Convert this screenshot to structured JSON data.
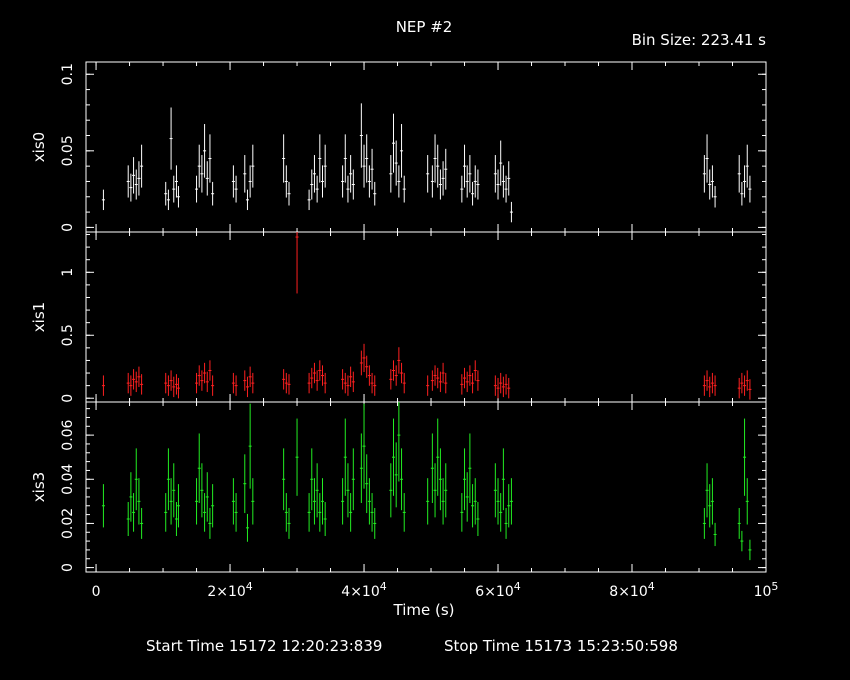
{
  "header": {
    "title": "NEP #2",
    "bin_size": "Bin Size: 223.41 s"
  },
  "footer": {
    "start_time": "Start Time 15172 12:20:23:839",
    "stop_time": "Stop Time 15173 15:23:50:598"
  },
  "chart_data": {
    "type": "scatter",
    "xlabel": "Time (s)",
    "xlim": [
      -1500,
      100000
    ],
    "x_ticks": [
      {
        "value": 0,
        "label": "0",
        "exp": ""
      },
      {
        "value": 20000,
        "label": "2×10",
        "exp": "4"
      },
      {
        "value": 40000,
        "label": "4×10",
        "exp": "4"
      },
      {
        "value": 60000,
        "label": "6×10",
        "exp": "4"
      },
      {
        "value": 80000,
        "label": "8×10",
        "exp": "4"
      },
      {
        "value": 100000,
        "label": "10",
        "exp": "5"
      }
    ],
    "panels": [
      {
        "name": "xis0",
        "ylabel": "xis0",
        "color": "#ffffff",
        "ylim": [
          -0.003,
          0.108
        ],
        "yticks": [
          0,
          0.05,
          0.1
        ],
        "ytick_labels": [
          "0",
          "0.05",
          "0.1"
        ],
        "points": [
          [
            1100,
            0.018
          ],
          [
            4800,
            0.03
          ],
          [
            5200,
            0.026
          ],
          [
            5600,
            0.034
          ],
          [
            6000,
            0.028
          ],
          [
            6400,
            0.032
          ],
          [
            6800,
            0.04
          ],
          [
            10400,
            0.022
          ],
          [
            10800,
            0.018
          ],
          [
            11200,
            0.058
          ],
          [
            11600,
            0.025
          ],
          [
            12000,
            0.03
          ],
          [
            12300,
            0.02
          ],
          [
            15000,
            0.025
          ],
          [
            15400,
            0.04
          ],
          [
            15800,
            0.035
          ],
          [
            16200,
            0.05
          ],
          [
            16600,
            0.032
          ],
          [
            17000,
            0.045
          ],
          [
            17400,
            0.022
          ],
          [
            20500,
            0.03
          ],
          [
            20900,
            0.025
          ],
          [
            22200,
            0.035
          ],
          [
            22600,
            0.018
          ],
          [
            23000,
            0.03
          ],
          [
            23400,
            0.04
          ],
          [
            28000,
            0.045
          ],
          [
            28400,
            0.03
          ],
          [
            28800,
            0.022
          ],
          [
            31800,
            0.018
          ],
          [
            32200,
            0.028
          ],
          [
            32600,
            0.035
          ],
          [
            33000,
            0.025
          ],
          [
            33400,
            0.045
          ],
          [
            33800,
            0.03
          ],
          [
            34200,
            0.04
          ],
          [
            36800,
            0.03
          ],
          [
            37200,
            0.045
          ],
          [
            37600,
            0.025
          ],
          [
            38000,
            0.035
          ],
          [
            38400,
            0.028
          ],
          [
            39600,
            0.06
          ],
          [
            40000,
            0.04
          ],
          [
            40400,
            0.045
          ],
          [
            40800,
            0.03
          ],
          [
            41200,
            0.038
          ],
          [
            41600,
            0.022
          ],
          [
            44000,
            0.035
          ],
          [
            44400,
            0.055
          ],
          [
            44800,
            0.042
          ],
          [
            45200,
            0.03
          ],
          [
            45600,
            0.05
          ],
          [
            46000,
            0.025
          ],
          [
            49500,
            0.035
          ],
          [
            50200,
            0.03
          ],
          [
            50600,
            0.045
          ],
          [
            51000,
            0.04
          ],
          [
            51400,
            0.028
          ],
          [
            51800,
            0.032
          ],
          [
            52200,
            0.038
          ],
          [
            54600,
            0.025
          ],
          [
            55000,
            0.04
          ],
          [
            55400,
            0.03
          ],
          [
            55800,
            0.035
          ],
          [
            56200,
            0.022
          ],
          [
            56600,
            0.03
          ],
          [
            57000,
            0.028
          ],
          [
            59600,
            0.035
          ],
          [
            60000,
            0.028
          ],
          [
            60400,
            0.042
          ],
          [
            60800,
            0.03
          ],
          [
            61200,
            0.025
          ],
          [
            61600,
            0.032
          ],
          [
            62000,
            0.01
          ],
          [
            90800,
            0.035
          ],
          [
            91200,
            0.045
          ],
          [
            91600,
            0.028
          ],
          [
            92000,
            0.03
          ],
          [
            92400,
            0.02
          ],
          [
            96000,
            0.035
          ],
          [
            96400,
            0.022
          ],
          [
            96800,
            0.03
          ],
          [
            97200,
            0.04
          ],
          [
            97600,
            0.025
          ]
        ]
      },
      {
        "name": "xis1",
        "ylabel": "xis1",
        "color": "#ff2020",
        "ylim": [
          -0.03,
          1.32
        ],
        "yticks": [
          0,
          0.5,
          1
        ],
        "ytick_labels": [
          "0",
          "0.5",
          "1"
        ],
        "points": [
          [
            1100,
            0.1
          ],
          [
            4800,
            0.12
          ],
          [
            5200,
            0.1
          ],
          [
            5600,
            0.15
          ],
          [
            6000,
            0.13
          ],
          [
            6400,
            0.17
          ],
          [
            6800,
            0.11
          ],
          [
            10400,
            0.12
          ],
          [
            10800,
            0.1
          ],
          [
            11200,
            0.14
          ],
          [
            11600,
            0.09
          ],
          [
            12000,
            0.11
          ],
          [
            12300,
            0.08
          ],
          [
            15000,
            0.12
          ],
          [
            15400,
            0.18
          ],
          [
            15800,
            0.14
          ],
          [
            16200,
            0.2
          ],
          [
            16600,
            0.13
          ],
          [
            17000,
            0.22
          ],
          [
            17400,
            0.1
          ],
          [
            20500,
            0.12
          ],
          [
            20900,
            0.1
          ],
          [
            22200,
            0.14
          ],
          [
            22600,
            0.09
          ],
          [
            23000,
            0.17
          ],
          [
            23400,
            0.12
          ],
          [
            28000,
            0.15
          ],
          [
            28400,
            0.12
          ],
          [
            28800,
            0.11
          ],
          [
            30000,
            1.28
          ],
          [
            31800,
            0.12
          ],
          [
            32200,
            0.16
          ],
          [
            32600,
            0.2
          ],
          [
            33000,
            0.14
          ],
          [
            33400,
            0.22
          ],
          [
            33800,
            0.18
          ],
          [
            34200,
            0.12
          ],
          [
            36800,
            0.15
          ],
          [
            37200,
            0.12
          ],
          [
            37600,
            0.1
          ],
          [
            38000,
            0.17
          ],
          [
            38400,
            0.13
          ],
          [
            39600,
            0.28
          ],
          [
            40000,
            0.32
          ],
          [
            40400,
            0.25
          ],
          [
            40800,
            0.18
          ],
          [
            41200,
            0.12
          ],
          [
            41600,
            0.1
          ],
          [
            44000,
            0.15
          ],
          [
            44400,
            0.22
          ],
          [
            44800,
            0.18
          ],
          [
            45200,
            0.3
          ],
          [
            45600,
            0.2
          ],
          [
            46000,
            0.12
          ],
          [
            49500,
            0.1
          ],
          [
            50200,
            0.14
          ],
          [
            50600,
            0.18
          ],
          [
            51000,
            0.16
          ],
          [
            51400,
            0.13
          ],
          [
            51800,
            0.2
          ],
          [
            52200,
            0.12
          ],
          [
            54600,
            0.11
          ],
          [
            55000,
            0.16
          ],
          [
            55400,
            0.13
          ],
          [
            55800,
            0.18
          ],
          [
            56200,
            0.12
          ],
          [
            56600,
            0.22
          ],
          [
            57000,
            0.14
          ],
          [
            59600,
            0.1
          ],
          [
            60000,
            0.08
          ],
          [
            60400,
            0.12
          ],
          [
            60800,
            0.09
          ],
          [
            61200,
            0.11
          ],
          [
            61600,
            0.08
          ],
          [
            90800,
            0.1
          ],
          [
            91200,
            0.14
          ],
          [
            91600,
            0.09
          ],
          [
            92000,
            0.12
          ],
          [
            92400,
            0.1
          ],
          [
            96000,
            0.08
          ],
          [
            96400,
            0.12
          ],
          [
            96800,
            0.1
          ],
          [
            97200,
            0.14
          ],
          [
            97600,
            0.07
          ]
        ]
      },
      {
        "name": "xis3",
        "ylabel": "xis3",
        "color": "#22ee22",
        "ylim": [
          -0.002,
          0.075
        ],
        "yticks": [
          0,
          0.02,
          0.04,
          0.06
        ],
        "ytick_labels": [
          "0",
          "0.02",
          "0.04",
          "0.06"
        ],
        "points": [
          [
            1100,
            0.028
          ],
          [
            4800,
            0.022
          ],
          [
            5200,
            0.032
          ],
          [
            5600,
            0.025
          ],
          [
            6000,
            0.04
          ],
          [
            6400,
            0.03
          ],
          [
            6800,
            0.02
          ],
          [
            10400,
            0.025
          ],
          [
            10800,
            0.04
          ],
          [
            11200,
            0.03
          ],
          [
            11600,
            0.035
          ],
          [
            12000,
            0.022
          ],
          [
            12300,
            0.028
          ],
          [
            15000,
            0.03
          ],
          [
            15400,
            0.045
          ],
          [
            15800,
            0.035
          ],
          [
            16200,
            0.025
          ],
          [
            16600,
            0.032
          ],
          [
            17000,
            0.02
          ],
          [
            17400,
            0.028
          ],
          [
            20500,
            0.03
          ],
          [
            20900,
            0.025
          ],
          [
            22200,
            0.038
          ],
          [
            22600,
            0.018
          ],
          [
            23000,
            0.055
          ],
          [
            23400,
            0.03
          ],
          [
            28000,
            0.04
          ],
          [
            28400,
            0.025
          ],
          [
            28800,
            0.02
          ],
          [
            30000,
            0.05
          ],
          [
            31800,
            0.025
          ],
          [
            32200,
            0.04
          ],
          [
            32600,
            0.03
          ],
          [
            33000,
            0.035
          ],
          [
            33400,
            0.025
          ],
          [
            33800,
            0.03
          ],
          [
            34200,
            0.022
          ],
          [
            36800,
            0.03
          ],
          [
            37200,
            0.05
          ],
          [
            37600,
            0.035
          ],
          [
            38000,
            0.025
          ],
          [
            38400,
            0.04
          ],
          [
            39600,
            0.045
          ],
          [
            40000,
            0.055
          ],
          [
            40400,
            0.038
          ],
          [
            40800,
            0.03
          ],
          [
            41200,
            0.025
          ],
          [
            41600,
            0.02
          ],
          [
            44000,
            0.035
          ],
          [
            44400,
            0.05
          ],
          [
            44800,
            0.042
          ],
          [
            45200,
            0.06
          ],
          [
            45600,
            0.04
          ],
          [
            46000,
            0.025
          ],
          [
            49500,
            0.03
          ],
          [
            50200,
            0.045
          ],
          [
            50600,
            0.035
          ],
          [
            51000,
            0.05
          ],
          [
            51400,
            0.04
          ],
          [
            51800,
            0.03
          ],
          [
            52200,
            0.035
          ],
          [
            54600,
            0.025
          ],
          [
            55000,
            0.04
          ],
          [
            55400,
            0.032
          ],
          [
            55800,
            0.045
          ],
          [
            56200,
            0.028
          ],
          [
            56600,
            0.03
          ],
          [
            57000,
            0.022
          ],
          [
            59600,
            0.035
          ],
          [
            60000,
            0.03
          ],
          [
            60400,
            0.025
          ],
          [
            60800,
            0.04
          ],
          [
            61200,
            0.02
          ],
          [
            61600,
            0.028
          ],
          [
            62000,
            0.03
          ],
          [
            90800,
            0.02
          ],
          [
            91200,
            0.035
          ],
          [
            91600,
            0.028
          ],
          [
            92000,
            0.03
          ],
          [
            92400,
            0.015
          ],
          [
            96000,
            0.02
          ],
          [
            96400,
            0.012
          ],
          [
            96800,
            0.05
          ],
          [
            97200,
            0.03
          ],
          [
            97600,
            0.008
          ]
        ]
      }
    ]
  }
}
